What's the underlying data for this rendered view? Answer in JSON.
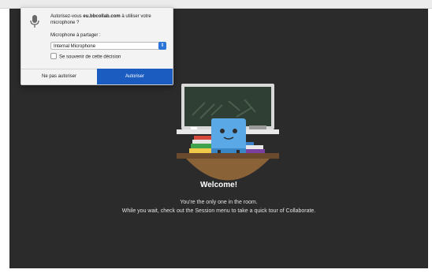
{
  "permission_dialog": {
    "prompt_prefix": "Autorisez-vous ",
    "domain": "eu.bbcollab.com",
    "prompt_suffix": " à utiliser votre microphone ?",
    "share_label": "Microphone à partager :",
    "selected_microphone": "Internal Microphone",
    "remember_label": "Se souvenir de cette décision",
    "remember_checked": false,
    "deny_label": "Ne pas autoriser",
    "allow_label": "Autoriser",
    "mic_icon": "microphone-icon",
    "select_arrow_icon": "select-arrow-icon"
  },
  "room": {
    "welcome_title": "Welcome!",
    "line1": "You're the only one in the room.",
    "line2": "While you wait, check out the Session menu to take a quick tour of Collaborate."
  },
  "colors": {
    "stage_background": "#2b2b2b",
    "allow_button": "#1a5cbf",
    "select_arrow": "#2a74d9"
  }
}
